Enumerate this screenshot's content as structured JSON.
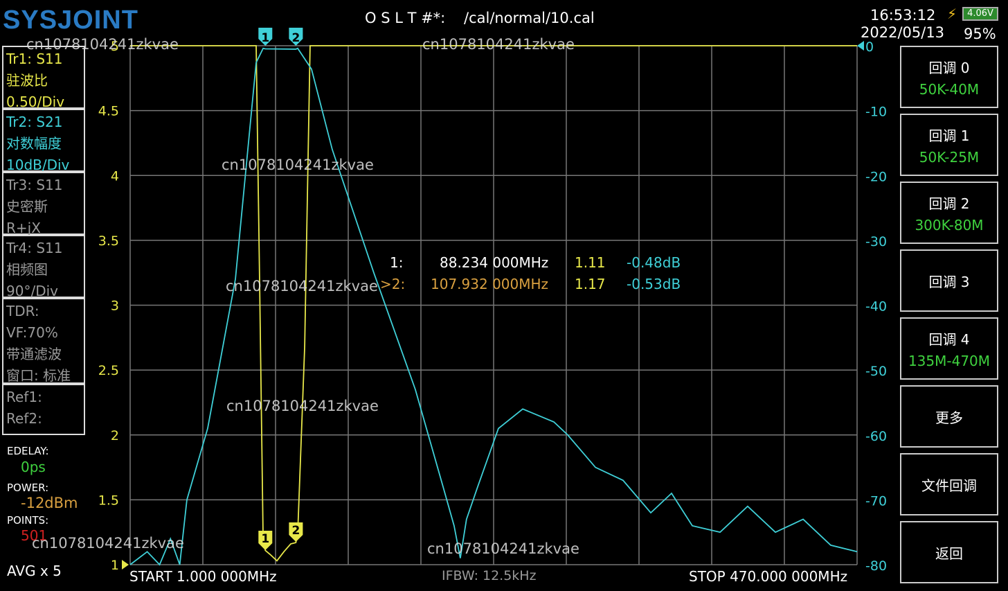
{
  "header": {
    "logo": "SYSJOINT",
    "cal_label": "O S L T #*:",
    "cal_file": "/cal/normal/10.cal",
    "time": "16:53:12",
    "date": "2022/05/13",
    "battery_voltage": "4.06V",
    "battery_percent": "95%"
  },
  "traces": [
    {
      "lines": [
        "Tr1:   S11",
        "驻波比",
        "0.50/Div"
      ]
    },
    {
      "lines": [
        "Tr2:   S21",
        "对数幅度",
        "10dB/Div"
      ]
    },
    {
      "lines": [
        "Tr3:   S11",
        "史密斯",
        "R+jX"
      ]
    },
    {
      "lines": [
        "Tr4:   S11",
        "相频图",
        "90°/Div"
      ]
    },
    {
      "lines": [
        "TDR:",
        "VF:70%",
        "带通滤波",
        "窗口: 标准"
      ]
    },
    {
      "lines": [
        "Ref1:",
        "Ref2:"
      ]
    }
  ],
  "settings": {
    "edelay_label": "EDELAY:",
    "edelay": "0ps",
    "power_label": "POWER:",
    "power": "-12dBm",
    "points_label": "POINTS:",
    "points": "501",
    "avg": "AVG x 5"
  },
  "footer": {
    "start": "START    1.000 000MHz",
    "ifbw": "IFBW: 12.5kHz",
    "stop": "STOP   470.000 000MHz"
  },
  "markers": [
    {
      "id": "1",
      "label": "1:",
      "freq": "88.234 000MHz",
      "swr": "1.11",
      "mag": "-0.48dB",
      "freq_mhz": 88.234
    },
    {
      "id": "2",
      "label": ">2:",
      "freq": "107.932 000MHz",
      "swr": "1.17",
      "mag": "-0.53dB",
      "freq_mhz": 107.932
    }
  ],
  "buttons": [
    {
      "title": "回调 0",
      "sub": "50K-40M"
    },
    {
      "title": "回调 1",
      "sub": "50K-25M"
    },
    {
      "title": "回调 2",
      "sub": "300K-80M"
    },
    {
      "title": "回调 3",
      "sub": ""
    },
    {
      "title": "回调 4",
      "sub": "135M-470M"
    },
    {
      "title": "更多",
      "sub": ""
    },
    {
      "title": "文件回调",
      "sub": ""
    },
    {
      "title": "返回",
      "sub": ""
    }
  ],
  "watermark": "cn1078104241zkvae",
  "chart_data": {
    "type": "line",
    "x_range_mhz": [
      1,
      470
    ],
    "left_axis": {
      "label": "SWR",
      "ticks": [
        "5",
        "4.5",
        "4",
        "3.5",
        "3",
        "2.5",
        "2",
        "1.5",
        "1"
      ],
      "range": [
        1,
        5
      ]
    },
    "right_axis": {
      "label": "dB",
      "ticks": [
        "0",
        "-10",
        "-20",
        "-30",
        "-40",
        "-50",
        "-60",
        "-70",
        "-80"
      ],
      "range": [
        -80,
        0
      ]
    },
    "grid": true,
    "series": [
      {
        "name": "Tr1 S11 SWR",
        "color": "#e8e84a",
        "axis": "left",
        "points": [
          [
            1,
            5
          ],
          [
            82.3,
            5
          ],
          [
            84.5,
            3.2
          ],
          [
            86.8,
            1.19
          ],
          [
            88.2,
            1.11
          ],
          [
            91.2,
            1.08
          ],
          [
            95.7,
            1.03
          ],
          [
            100.2,
            1.1
          ],
          [
            104.6,
            1.16
          ],
          [
            107.9,
            1.17
          ],
          [
            109.1,
            1.24
          ],
          [
            113.6,
            2.68
          ],
          [
            117.1,
            5
          ],
          [
            470,
            5
          ]
        ]
      },
      {
        "name": "Tr2 S21 LogMag",
        "color": "#3fd0d8",
        "axis": "right",
        "points": [
          [
            1,
            -80
          ],
          [
            12,
            -78
          ],
          [
            20,
            -80
          ],
          [
            27,
            -76
          ],
          [
            33,
            -80
          ],
          [
            37.6,
            -70
          ],
          [
            51,
            -59
          ],
          [
            68.9,
            -36
          ],
          [
            82.3,
            -2.6
          ],
          [
            86.8,
            -0.4
          ],
          [
            88.2,
            -0.48
          ],
          [
            107.9,
            -0.53
          ],
          [
            109.1,
            -0.4
          ],
          [
            118,
            -3.6
          ],
          [
            131.4,
            -16
          ],
          [
            158.2,
            -35
          ],
          [
            185,
            -53
          ],
          [
            202.9,
            -68
          ],
          [
            210,
            -74
          ],
          [
            214,
            -79
          ],
          [
            218,
            -73
          ],
          [
            225.2,
            -68
          ],
          [
            238.6,
            -59
          ],
          [
            254.3,
            -56
          ],
          [
            274.4,
            -58
          ],
          [
            283.3,
            -60
          ],
          [
            301.2,
            -65
          ],
          [
            319,
            -67
          ],
          [
            336.9,
            -72
          ],
          [
            350.3,
            -69
          ],
          [
            363.7,
            -74
          ],
          [
            381.6,
            -75
          ],
          [
            399.4,
            -71
          ],
          [
            417.3,
            -75
          ],
          [
            435.2,
            -73
          ],
          [
            453,
            -77
          ],
          [
            470,
            -78
          ]
        ]
      }
    ]
  }
}
